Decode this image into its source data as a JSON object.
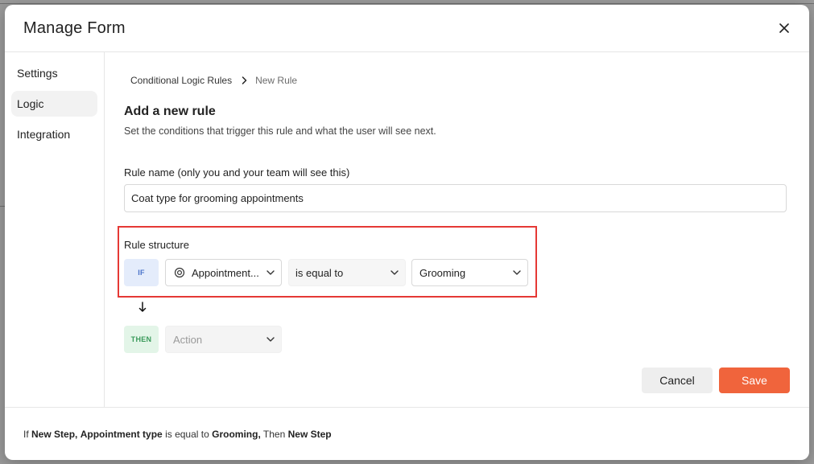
{
  "modal": {
    "title": "Manage Form"
  },
  "sidebar": {
    "items": [
      {
        "label": "Settings",
        "active": false
      },
      {
        "label": "Logic",
        "active": true
      },
      {
        "label": "Integration",
        "active": false
      }
    ]
  },
  "breadcrumb": {
    "parent": "Conditional Logic Rules",
    "current": "New Rule"
  },
  "section": {
    "title": "Add a new rule",
    "subtitle": "Set the conditions that trigger this rule and what the user will see next."
  },
  "rule_name": {
    "label": "Rule name (only you and your team will see this)",
    "value": "Coat type for grooming appointments"
  },
  "rule_structure": {
    "label": "Rule structure",
    "if_badge": "IF",
    "then_badge": "THEN",
    "field_select": "Appointment...",
    "operator_select": "is equal to",
    "value_select": "Grooming",
    "action_select": "Action"
  },
  "footer": {
    "summary": {
      "if_word": "If",
      "step": "New Step,",
      "field": "Appointment type",
      "operator": "is equal to",
      "value": "Grooming,",
      "then_word": "Then",
      "target": "New Step"
    },
    "cancel_label": "Cancel",
    "save_label": "Save"
  },
  "colors": {
    "accent": "#f0643c",
    "highlight_border": "#e53935",
    "if_badge_bg": "#e4ecfb",
    "then_badge_bg": "#e3f5e8"
  },
  "icons": {
    "close": "close-icon",
    "breadcrumb_sep": "chevron-right-icon",
    "field_type": "target-icon",
    "dropdown": "chevron-down-icon",
    "flow": "arrow-down-icon"
  }
}
